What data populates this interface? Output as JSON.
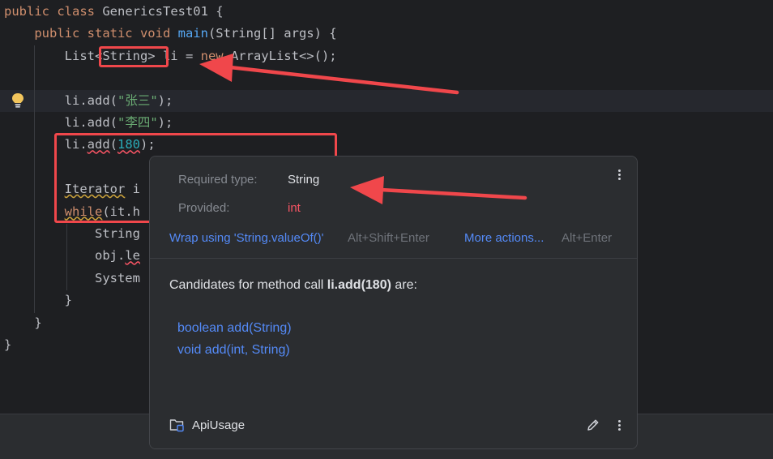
{
  "editor": {
    "lines": [
      {
        "tokens": [
          {
            "t": "public class ",
            "c": "kw"
          },
          {
            "t": "GenericsTest01 {",
            "c": "plain"
          }
        ]
      },
      {
        "tokens": [
          {
            "t": "    public static void ",
            "c": "kw"
          },
          {
            "t": "main",
            "c": "fn"
          },
          {
            "t": "(String[] args) {",
            "c": "plain"
          }
        ]
      },
      {
        "tokens": [
          {
            "t": "        List<String> li = ",
            "c": "plain"
          },
          {
            "t": "new ",
            "c": "kw"
          },
          {
            "t": "ArrayList<>();",
            "c": "plain"
          }
        ]
      },
      {
        "tokens": [
          {
            "t": "",
            "c": "plain"
          }
        ]
      },
      {
        "tokens": [
          {
            "t": "        li.add(",
            "c": "plain"
          },
          {
            "t": "\"张三\"",
            "c": "str"
          },
          {
            "t": ");",
            "c": "plain"
          }
        ]
      },
      {
        "tokens": [
          {
            "t": "        li.add(",
            "c": "plain"
          },
          {
            "t": "\"李四\"",
            "c": "str"
          },
          {
            "t": ");",
            "c": "plain"
          }
        ]
      },
      {
        "tokens": [
          {
            "t": "        li.",
            "c": "plain"
          },
          {
            "t": "add",
            "c": "plain",
            "sq": "err"
          },
          {
            "t": "(",
            "c": "plain"
          },
          {
            "t": "180",
            "c": "num",
            "sq": "err"
          },
          {
            "t": ");",
            "c": "plain"
          }
        ]
      },
      {
        "tokens": [
          {
            "t": "",
            "c": "plain"
          }
        ]
      },
      {
        "tokens": [
          {
            "t": "        ",
            "c": "plain"
          },
          {
            "t": "Iterator",
            "c": "plain",
            "sq": "warn"
          },
          {
            "t": " i",
            "c": "plain"
          }
        ]
      },
      {
        "tokens": [
          {
            "t": "        ",
            "c": "plain"
          },
          {
            "t": "while",
            "c": "kw",
            "sq": "warn"
          },
          {
            "t": "(it.h",
            "c": "plain"
          }
        ]
      },
      {
        "tokens": [
          {
            "t": "            String",
            "c": "plain"
          }
        ]
      },
      {
        "tokens": [
          {
            "t": "            obj.",
            "c": "plain"
          },
          {
            "t": "le",
            "c": "plain",
            "sq": "err"
          }
        ]
      },
      {
        "tokens": [
          {
            "t": "            System",
            "c": "plain"
          }
        ]
      },
      {
        "tokens": [
          {
            "t": "        }",
            "c": "plain"
          }
        ]
      },
      {
        "tokens": [
          {
            "t": "    }",
            "c": "plain"
          }
        ]
      },
      {
        "tokens": [
          {
            "t": "}",
            "c": "plain"
          }
        ]
      }
    ],
    "caret_line": 4,
    "colors": {
      "keyword": "#cf8e6d",
      "function": "#56a8f5",
      "string": "#6aab73",
      "number": "#2aacb8",
      "text": "#bcbec4",
      "error": "#f75464",
      "annotation": "#f0474b"
    }
  },
  "popup": {
    "required_label": "Required type:",
    "required_value": "String",
    "provided_label": "Provided:",
    "provided_value": "int",
    "fix_action": "Wrap using 'String.valueOf()'",
    "fix_shortcut": "Alt+Shift+Enter",
    "more_actions": "More actions...",
    "more_shortcut": "Alt+Enter",
    "candidates_prefix": "Candidates for method call ",
    "candidates_call": "li.add(180)",
    "candidates_suffix": " are:",
    "candidates": [
      "boolean add(String)",
      "void add(int, String)"
    ],
    "inspection_name": "ApiUsage",
    "icons": [
      "more-vertical-icon",
      "folder-icon",
      "edit-icon",
      "lightbulb-icon"
    ]
  }
}
